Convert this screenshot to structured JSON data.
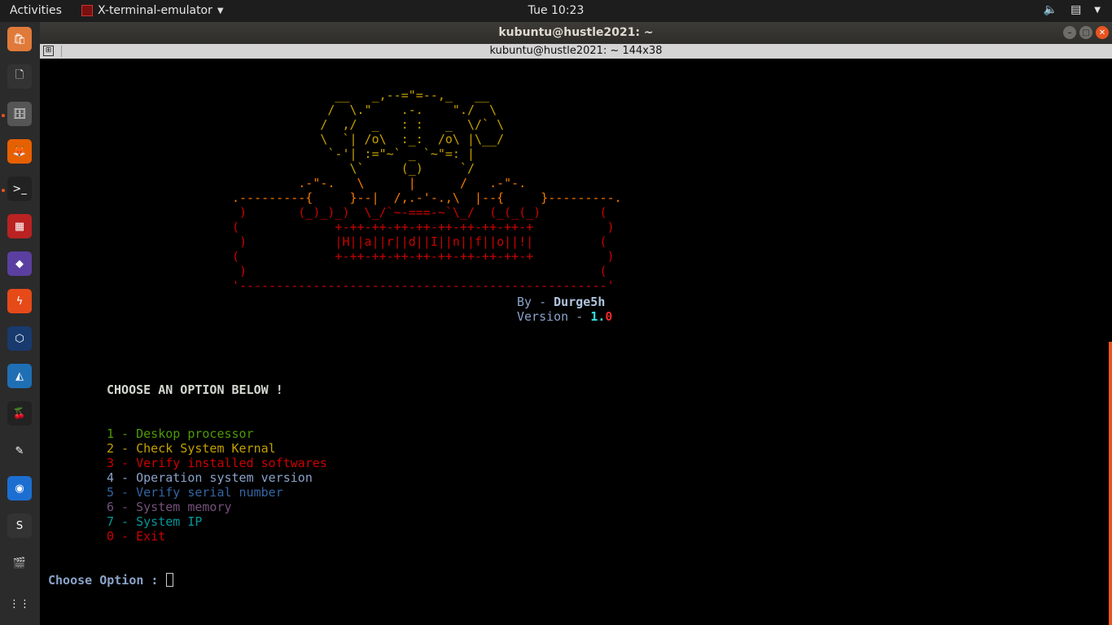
{
  "topbar": {
    "activities": "Activities",
    "app_name": "X-terminal-emulator",
    "clock": "Tue 10:23",
    "tray": {
      "volume_icon": "volume-icon",
      "battery_icon": "battery-icon",
      "menu_icon": "caret-down-icon"
    }
  },
  "dock": {
    "items": [
      {
        "name": "ubuntu-software-icon",
        "glyph": "🛍"
      },
      {
        "name": "files-icon",
        "glyph": "🗋"
      },
      {
        "name": "file-cabinet-icon",
        "glyph": "🗄"
      },
      {
        "name": "firefox-icon",
        "glyph": "🦊"
      },
      {
        "name": "terminal-icon",
        "glyph": ">_"
      },
      {
        "name": "red-app-icon",
        "glyph": "▦"
      },
      {
        "name": "crystal-icon",
        "glyph": "◆"
      },
      {
        "name": "lightning-icon",
        "glyph": "ϟ"
      },
      {
        "name": "virtualbox-icon",
        "glyph": "⬡"
      },
      {
        "name": "wireshark-icon",
        "glyph": "◭"
      },
      {
        "name": "cherry-icon",
        "glyph": "🍒"
      },
      {
        "name": "text-editor-icon",
        "glyph": "✎"
      },
      {
        "name": "chromium-icon",
        "glyph": "◉"
      },
      {
        "name": "sublime-icon",
        "glyph": "S"
      },
      {
        "name": "video-editor-icon",
        "glyph": "🎬"
      },
      {
        "name": "show-apps-icon",
        "glyph": "⋮⋮"
      }
    ]
  },
  "window": {
    "title": "kubuntu@hustle2021: ~",
    "subtitle": "kubuntu@hustle2021: ~ 144x38"
  },
  "terminal": {
    "banner": [
      "              __   _,--=\"=--,_   __",
      "             /  \\.\"    .-.    \"./  \\",
      "            /  ,/  _   : :   _  \\/` \\",
      "            \\  `| /o\\  :_:  /o\\ |\\__/",
      "             `-'| :=\"~` _ `~\"=: |",
      "                \\`     (_)     `/",
      "         .-\"-.   \\      |      /   .-\"-.",
      ".---------{     }--|  /,.-'-.,\\  |--{     }---------.",
      " )       (_)_)_)  \\_/`~-===-~`\\_/  (_(_(_)        (",
      "(             +-++-++-++-++-++-++-++-++-+          )",
      " )            |H||a||r||d||I||n||f||o||!|         (",
      "(             +-++-++-++-++-++-++-++-++-+          )",
      " )                                                (",
      "'--------------------------------------------------'"
    ],
    "by_label": "By - ",
    "author": "Durge5h",
    "version_label": "Version - ",
    "version_major": "1.",
    "version_minor": "0",
    "choose_heading": "CHOOSE AN OPTION BELOW !",
    "options": [
      {
        "num": "1",
        "label": "Deskop processor",
        "color": "#4e9a06"
      },
      {
        "num": "2",
        "label": "Check System Kernal",
        "color": "#c4a000"
      },
      {
        "num": "3",
        "label": "Verify installed softwares",
        "color": "#cc0000"
      },
      {
        "num": "4",
        "label": "Operation system version",
        "color": "#8aa2c8"
      },
      {
        "num": "5",
        "label": "Verify serial number",
        "color": "#3465a4"
      },
      {
        "num": "6",
        "label": "System memory",
        "color": "#75507b"
      },
      {
        "num": "7",
        "label": "System IP",
        "color": "#06989a"
      },
      {
        "num": "0",
        "label": "Exit",
        "color": "#cc0000"
      }
    ],
    "prompt": "Choose Option : ",
    "colors": {
      "banner_top": "#c4a000",
      "banner_mid": "#f57900",
      "banner_low": "#cc0000",
      "banner_right": "#c000c0",
      "heading": "#d3d7cf",
      "by": "#8aa2c8",
      "author": "#b0c4de",
      "version_major": "#34e2e2",
      "version_minor": "#ef2929",
      "prompt": "#8aa2c8"
    }
  }
}
